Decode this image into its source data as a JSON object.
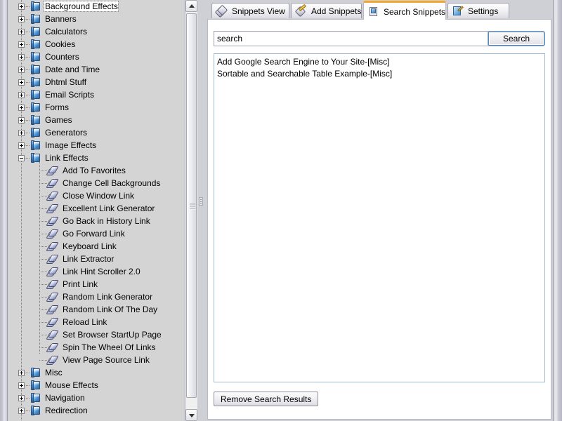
{
  "window": {
    "background_color": "#cfcfd6",
    "accent_color": "#f0a830"
  },
  "tree": {
    "selected_item": "Background Effects",
    "nodes": [
      {
        "label": "Background Effects",
        "type": "folder",
        "state": "collapsed",
        "selected": true
      },
      {
        "label": "Banners",
        "type": "folder",
        "state": "collapsed",
        "selected": false
      },
      {
        "label": "Calculators",
        "type": "folder",
        "state": "collapsed",
        "selected": false
      },
      {
        "label": "Cookies",
        "type": "folder",
        "state": "collapsed",
        "selected": false
      },
      {
        "label": "Counters",
        "type": "folder",
        "state": "collapsed",
        "selected": false
      },
      {
        "label": "Date and Time",
        "type": "folder",
        "state": "collapsed",
        "selected": false
      },
      {
        "label": "Dhtml Stuff",
        "type": "folder",
        "state": "collapsed",
        "selected": false
      },
      {
        "label": "Email Scripts",
        "type": "folder",
        "state": "collapsed",
        "selected": false
      },
      {
        "label": "Forms",
        "type": "folder",
        "state": "collapsed",
        "selected": false
      },
      {
        "label": "Games",
        "type": "folder",
        "state": "collapsed",
        "selected": false
      },
      {
        "label": "Generators",
        "type": "folder",
        "state": "collapsed",
        "selected": false
      },
      {
        "label": "Image Effects",
        "type": "folder",
        "state": "collapsed",
        "selected": false
      },
      {
        "label": "Link Effects",
        "type": "folder",
        "state": "expanded",
        "selected": false
      },
      {
        "label": "Add To Favorites",
        "type": "snippet",
        "state": "leaf",
        "selected": false
      },
      {
        "label": "Change Cell Backgrounds",
        "type": "snippet",
        "state": "leaf",
        "selected": false
      },
      {
        "label": "Close Window Link",
        "type": "snippet",
        "state": "leaf",
        "selected": false
      },
      {
        "label": "Excellent Link Generator",
        "type": "snippet",
        "state": "leaf",
        "selected": false
      },
      {
        "label": "Go Back in History Link",
        "type": "snippet",
        "state": "leaf",
        "selected": false
      },
      {
        "label": "Go Forward Link",
        "type": "snippet",
        "state": "leaf",
        "selected": false
      },
      {
        "label": "Keyboard Link",
        "type": "snippet",
        "state": "leaf",
        "selected": false
      },
      {
        "label": "Link Extractor",
        "type": "snippet",
        "state": "leaf",
        "selected": false
      },
      {
        "label": "Link Hint Scroller 2.0",
        "type": "snippet",
        "state": "leaf",
        "selected": false
      },
      {
        "label": "Print Link",
        "type": "snippet",
        "state": "leaf",
        "selected": false
      },
      {
        "label": "Random Link Generator",
        "type": "snippet",
        "state": "leaf",
        "selected": false
      },
      {
        "label": "Random Link Of The Day",
        "type": "snippet",
        "state": "leaf",
        "selected": false
      },
      {
        "label": "Reload Link",
        "type": "snippet",
        "state": "leaf",
        "selected": false
      },
      {
        "label": "Set Browser StartUp Page",
        "type": "snippet",
        "state": "leaf",
        "selected": false
      },
      {
        "label": "Spin The Wheel Of Links",
        "type": "snippet",
        "state": "leaf",
        "selected": false
      },
      {
        "label": "View Page Source Link",
        "type": "snippet",
        "state": "leaf",
        "selected": false
      },
      {
        "label": "Misc",
        "type": "folder",
        "state": "collapsed",
        "selected": false
      },
      {
        "label": "Mouse Effects",
        "type": "folder",
        "state": "collapsed",
        "selected": false
      },
      {
        "label": "Navigation",
        "type": "folder",
        "state": "collapsed",
        "selected": false
      },
      {
        "label": "Redirection",
        "type": "folder",
        "state": "collapsed",
        "selected": false
      }
    ]
  },
  "tabs": [
    {
      "label": "Snippets View",
      "icon": "diamond-icon",
      "active": false
    },
    {
      "label": "Add Snippets",
      "icon": "diamond-pencil-icon",
      "active": false
    },
    {
      "label": "Search Snippets",
      "icon": "page-search-icon",
      "active": true
    },
    {
      "label": "Settings",
      "icon": "settings-page-icon",
      "active": false
    }
  ],
  "search": {
    "value": "search",
    "placeholder": "",
    "button_label": "Search"
  },
  "results": {
    "items": [
      "Add Google Search Engine to Your Site-[Misc]",
      "Sortable and Searchable Table Example-[Misc]"
    ]
  },
  "actions": {
    "remove_results_label": "Remove Search Results"
  }
}
